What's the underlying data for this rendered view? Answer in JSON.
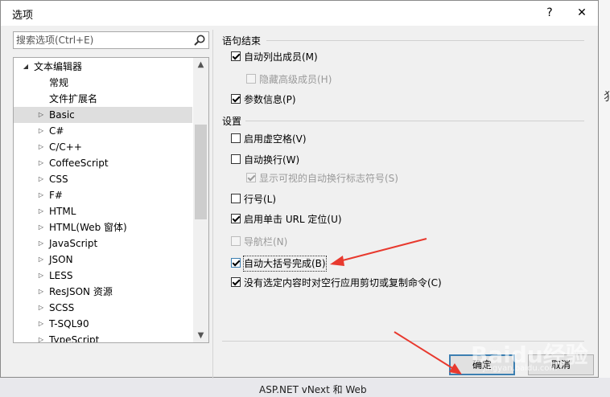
{
  "window": {
    "title": "选项",
    "help": "?",
    "close": "✕"
  },
  "search": {
    "placeholder": "搜索选项(Ctrl+E)"
  },
  "tree": {
    "items": [
      {
        "label": "文本编辑器",
        "arrow": "◢"
      },
      {
        "label": "常规",
        "arrow": ""
      },
      {
        "label": "文件扩展名",
        "arrow": ""
      },
      {
        "label": "Basic",
        "arrow": "▷"
      },
      {
        "label": "C#",
        "arrow": "▷"
      },
      {
        "label": "C/C++",
        "arrow": "▷"
      },
      {
        "label": "CoffeeScript",
        "arrow": "▷"
      },
      {
        "label": "CSS",
        "arrow": "▷"
      },
      {
        "label": "F#",
        "arrow": "▷"
      },
      {
        "label": "HTML",
        "arrow": "▷"
      },
      {
        "label": "HTML(Web 窗体)",
        "arrow": "▷"
      },
      {
        "label": "JavaScript",
        "arrow": "▷"
      },
      {
        "label": "JSON",
        "arrow": "▷"
      },
      {
        "label": "LESS",
        "arrow": "▷"
      },
      {
        "label": "ResJSON 资源",
        "arrow": "▷"
      },
      {
        "label": "SCSS",
        "arrow": "▷"
      },
      {
        "label": "T-SQL90",
        "arrow": "▷"
      },
      {
        "label": "TypeScript",
        "arrow": "▷"
      }
    ],
    "selected": "Basic",
    "scroll_up": "▲",
    "scroll_down": "▼"
  },
  "statement_completion": {
    "header": "语句结束",
    "auto_list_members": {
      "label": "自动列出成员(M)",
      "checked": true
    },
    "hide_advanced_members": {
      "label": "隐藏高级成员(H)",
      "checked": false
    },
    "parameter_info": {
      "label": "参数信息(P)",
      "checked": true
    }
  },
  "settings": {
    "header": "设置",
    "virtual_space": {
      "label": "启用虚空格(V)",
      "checked": false
    },
    "word_wrap": {
      "label": "自动换行(W)",
      "checked": false
    },
    "show_wrap_glyphs": {
      "label": "显示可视的自动换行标志符号(S)",
      "checked": true
    },
    "line_numbers": {
      "label": "行号(L)",
      "checked": false
    },
    "single_click_url": {
      "label": "启用单击 URL 定位(U)",
      "checked": true
    },
    "navigation_bar": {
      "label": "导航栏(N)",
      "checked": false
    },
    "auto_brace": {
      "label": "自动大括号完成(B)",
      "checked": true
    },
    "cut_copy_blank": {
      "label": "没有选定内容时对空行应用剪切或复制命令(C)",
      "checked": true
    }
  },
  "buttons": {
    "ok": "确定",
    "cancel": "取消"
  },
  "background": {
    "bottom_text": "ASP.NET vNext 和 Web"
  },
  "watermark": {
    "main": "Baidu经验",
    "sub": "jingyan.baidu.com"
  },
  "colors": {
    "accent": "#3c7fb1",
    "annotation_arrow": "#e8392e"
  }
}
